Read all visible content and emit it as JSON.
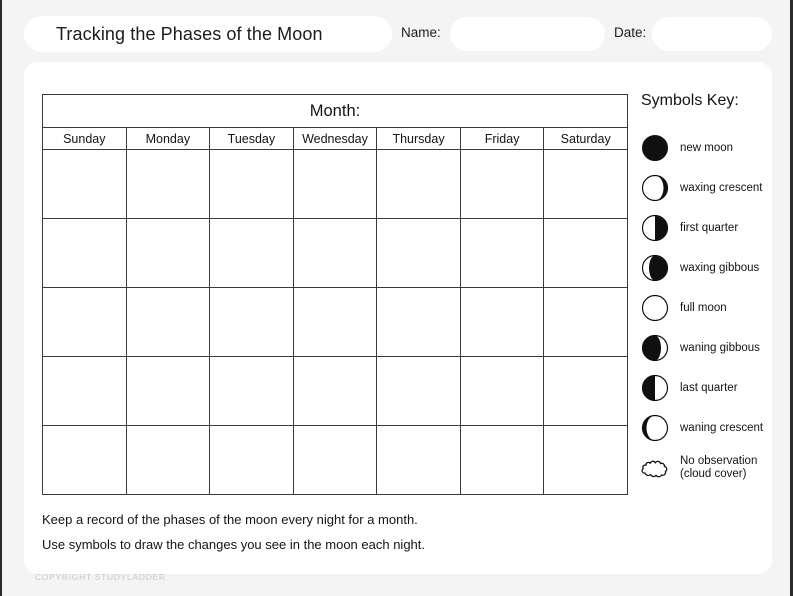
{
  "header": {
    "title": "Tracking the Phases of the Moon",
    "name_label": "Name:",
    "name_value": "",
    "name_placeholder": "",
    "date_label": "Date:",
    "date_value": "",
    "date_placeholder": ""
  },
  "calendar": {
    "month_label": "Month:",
    "days": [
      "Sunday",
      "Monday",
      "Tuesday",
      "Wednesday",
      "Thursday",
      "Friday",
      "Saturday"
    ],
    "rows": 5,
    "columns": 7
  },
  "symbols_key": {
    "title": "Symbols Key:",
    "items": [
      {
        "icon": "new-moon-icon",
        "label": "new moon"
      },
      {
        "icon": "waxing-crescent-icon",
        "label": "waxing crescent"
      },
      {
        "icon": "first-quarter-icon",
        "label": "first quarter"
      },
      {
        "icon": "waxing-gibbous-icon",
        "label": "waxing gibbous"
      },
      {
        "icon": "full-moon-icon",
        "label": "full moon"
      },
      {
        "icon": "waning-gibbous-icon",
        "label": "waning gibbous"
      },
      {
        "icon": "last-quarter-icon",
        "label": "last quarter"
      },
      {
        "icon": "waning-crescent-icon",
        "label": "waning crescent"
      },
      {
        "icon": "cloud-icon",
        "label": "No observation (cloud cover)"
      }
    ]
  },
  "instructions": {
    "line1": "Keep a record of the phases of the moon every night for a month.",
    "line2": "Use symbols to draw the changes you see in the moon each night."
  },
  "footer": {
    "copyright": "COPYRIGHT STUDYLADDER"
  },
  "colors": {
    "page_background": "#f4f4f4",
    "card_background": "#ffffff",
    "ink": "#141414",
    "grid_line": "#3a3a3a",
    "copyright_gray": "#c8c8c8"
  }
}
